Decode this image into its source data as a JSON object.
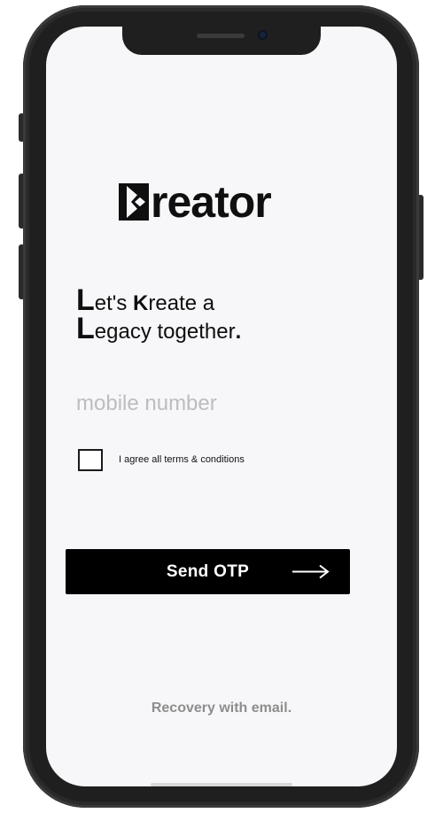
{
  "app": {
    "brand_name": "reator",
    "brand_letter": "K"
  },
  "tagline": {
    "line1_initial": "L",
    "line1_pre": "et's ",
    "line1_accent": "K",
    "line1_post": "reate a",
    "line2_initial": "L",
    "line2_text": "egacy together",
    "line2_end": "."
  },
  "form": {
    "mobile_placeholder": "mobile number",
    "mobile_value": "",
    "terms_checked": false,
    "terms_label": "I agree all terms & conditions"
  },
  "actions": {
    "send_otp_label": "Send OTP",
    "arrow_icon": "arrow-right-icon",
    "recovery_label": "Recovery with email."
  },
  "colors": {
    "brand": "#0f0f0f",
    "button_bg": "#000000",
    "button_text": "#ffffff",
    "placeholder": "#bdbdbd",
    "muted_link": "#8d8d8d",
    "screen_bg": "#f7f7fa"
  }
}
